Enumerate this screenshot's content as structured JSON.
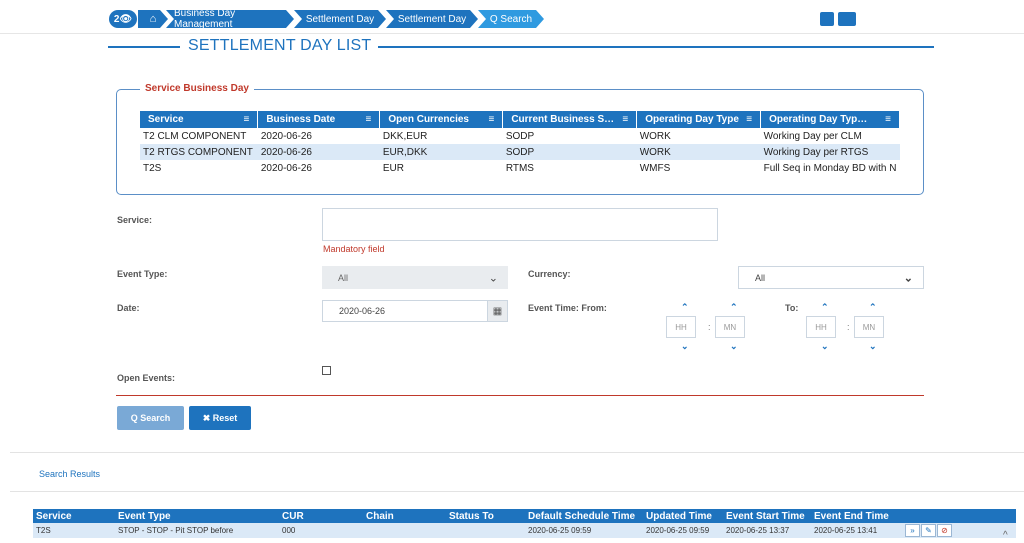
{
  "breadcrumb": {
    "badge": "2👁",
    "home_icon": "home-icon",
    "items": [
      "Business Day Management",
      "Settlement Day",
      "Settlement Day",
      "Q Search"
    ]
  },
  "page_title": "SETTLEMENT DAY LIST",
  "service_business_day": {
    "legend": "Service Business Day",
    "columns": [
      "Service",
      "Business Date",
      "Open Currencies",
      "Current Business S…",
      "Operating Day Type",
      "Operating Day Typ…"
    ],
    "rows": [
      [
        "T2 CLM COMPONENT",
        "2020-06-26",
        "DKK,EUR",
        "SODP",
        "WORK",
        "Working Day per CLM"
      ],
      [
        "T2 RTGS COMPONENT",
        "2020-06-26",
        "EUR,DKK",
        "SODP",
        "WORK",
        "Working Day per RTGS"
      ],
      [
        "T2S",
        "2020-06-26",
        "EUR",
        "RTMS",
        "WMFS",
        "Full Seq in Monday BD with N"
      ]
    ]
  },
  "form": {
    "service_label": "Service:",
    "service_value": "",
    "mandatory": "Mandatory field",
    "event_type_label": "Event Type:",
    "event_type_value": "All",
    "currency_label": "Currency:",
    "currency_value": "All",
    "date_label": "Date:",
    "date_value": "2020-06-26",
    "event_time_from_label": "Event Time: From:",
    "to_label": "To:",
    "hh": "HH",
    "mm": "MN",
    "open_events_label": "Open Events:",
    "search_button": "Q Search",
    "reset_button": "✖ Reset"
  },
  "results": {
    "label": "Search Results",
    "columns": [
      "Service",
      "Event Type",
      "CUR",
      "Chain",
      "Status To",
      "Default Schedule Time",
      "Updated Time",
      "Event Start Time",
      "Event End Time",
      ""
    ],
    "rows": [
      [
        "T2S",
        "STOP - STOP - Pit STOP before",
        "000",
        "",
        "",
        "2020-06-25 09:59",
        "2020-06-25 09:59",
        "2020-06-25 13:37",
        "2020-06-25 13:41"
      ]
    ]
  },
  "colors": {
    "accent": "#1e73be",
    "error": "#c0392b",
    "row_alt": "#dbe9f7"
  }
}
